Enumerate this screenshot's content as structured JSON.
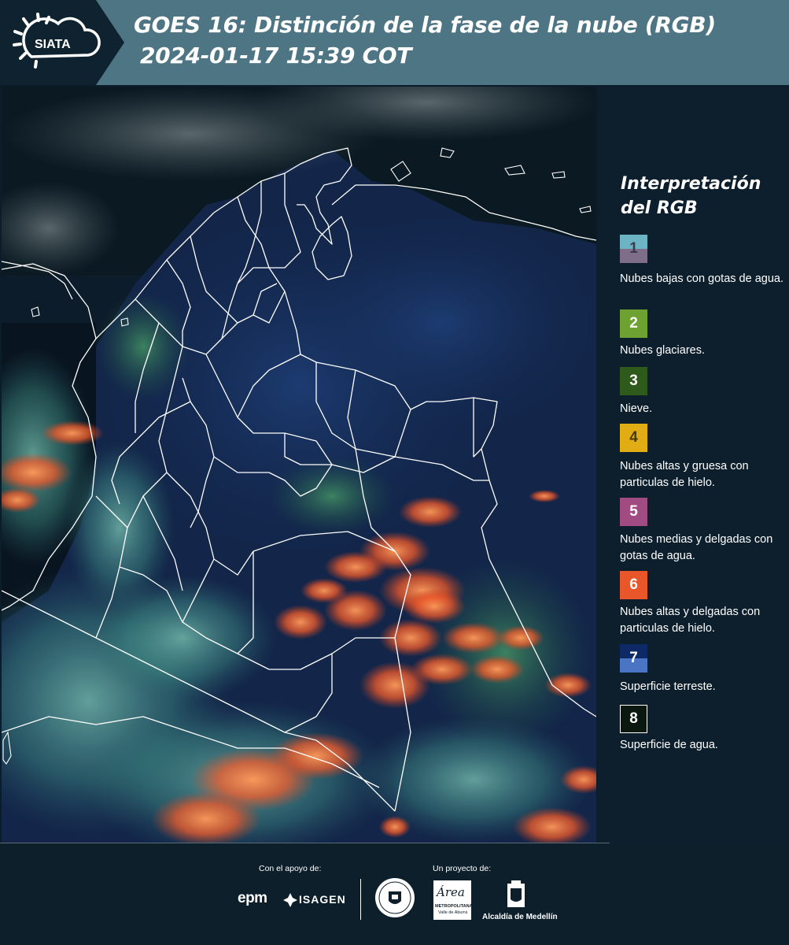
{
  "header": {
    "logo_text": "SIATA",
    "title_line1": "GOES 16: Distinción de la fase de la nube (RGB)",
    "title_line2": "2024-01-17 15:39 COT"
  },
  "legend": {
    "title_line1": "Interpretación",
    "title_line2": "del RGB",
    "items": [
      {
        "number": "1",
        "label": "Nubes bajas con gotas de agua.",
        "color_top": "#6cb3c4",
        "color_bottom": "#7f6e8a",
        "number_color": "#3a3a4a"
      },
      {
        "number": "2",
        "label": "Nubes glaciares.",
        "color": "#6da132",
        "number_color": "#ffffff"
      },
      {
        "number": "3",
        "label": "Nieve.",
        "color": "#2e5b1c",
        "number_color": "#ffffff"
      },
      {
        "number": "4",
        "label": "Nubes altas y gruesa con particulas de hielo.",
        "color": "#e0ad14",
        "number_color": "#4a3a08"
      },
      {
        "number": "5",
        "label": "Nubes medias y delgadas con gotas de agua.",
        "color": "#a04b82",
        "number_color": "#ffffff"
      },
      {
        "number": "6",
        "label": "Nubes altas y delgadas con particulas de hielo.",
        "color": "#e8562a",
        "number_color": "#ffffff"
      },
      {
        "number": "7",
        "label": "Superficie terreste.",
        "color_top": "#0e2a66",
        "color_bottom": "#4a75c4",
        "number_color": "#ffffff"
      },
      {
        "number": "8",
        "label": "Superficie de agua.",
        "color": "#0a1810",
        "border": "#ffffff",
        "number_color": "#ffffff"
      }
    ]
  },
  "footer": {
    "support_caption": "Con el apoyo de:",
    "project_caption": "Un proyecto de:",
    "sponsor1": "epm",
    "sponsor2": "ISAGEN",
    "partner2_line1": "Área",
    "partner2_line2": "METROPOLITANA",
    "partner2_line3": "Valle de Aburrá",
    "partner3": "Alcaldía de Medellín"
  },
  "colors": {
    "header_bg": "#4e7583",
    "panel_bg": "#0d1f2d",
    "border_lines": "#ffffff"
  }
}
